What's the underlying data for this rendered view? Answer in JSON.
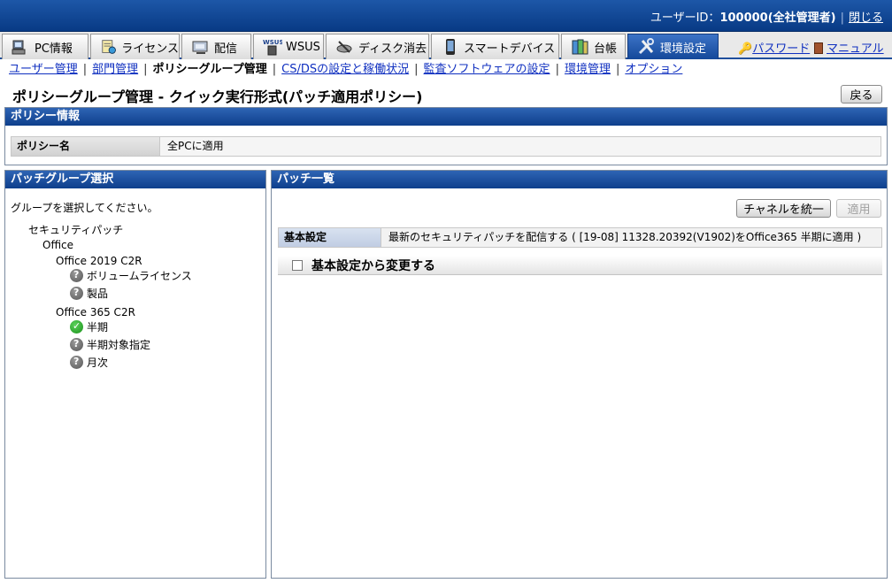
{
  "header": {
    "user_label": "ユーザーID：",
    "user_value": "100000(全社管理者)",
    "close_label": "閉じる"
  },
  "menu": {
    "tabs": [
      {
        "label": "PC情報",
        "icon": "pc-icon"
      },
      {
        "label": "ライセンス",
        "icon": "license-icon"
      },
      {
        "label": "配信",
        "icon": "distribution-icon"
      },
      {
        "label": "WSUS",
        "icon": "wsus-icon"
      },
      {
        "label": "ディスク消去",
        "icon": "disk-erase-icon"
      },
      {
        "label": "スマートデバイス",
        "icon": "smart-device-icon"
      },
      {
        "label": "台帳",
        "icon": "ledger-icon"
      },
      {
        "label": "環境設定",
        "icon": "settings-tools-icon"
      }
    ],
    "password_label": "パスワード",
    "manual_label": "マニュアル"
  },
  "subnav": {
    "items": [
      "ユーザー管理",
      "部門管理",
      "ポリシーグループ管理",
      "CS/DSの設定と稼働状況",
      "監査ソフトウェアの設定",
      "環境管理",
      "オプション"
    ]
  },
  "page": {
    "title": "ポリシーグループ管理 - クイック実行形式(パッチ適用ポリシー)",
    "back_label": "戻る"
  },
  "policy_info": {
    "heading": "ポリシー情報",
    "name_label": "ポリシー名",
    "name_value": "全PCに適用"
  },
  "patch_group": {
    "heading": "パッチグループ選択",
    "instruction": "グループを選択してください。",
    "tree": {
      "root": "セキュリティパッチ",
      "level1": "Office",
      "group_a": "Office 2019 C2R",
      "group_a_items": [
        {
          "label": "ボリュームライセンス",
          "status": "unknown"
        },
        {
          "label": "製品",
          "status": "unknown"
        }
      ],
      "group_b": "Office 365 C2R",
      "group_b_items": [
        {
          "label": "半期",
          "status": "applied"
        },
        {
          "label": "半期対象指定",
          "status": "unknown"
        },
        {
          "label": "月次",
          "status": "unknown"
        }
      ]
    }
  },
  "patch_list": {
    "heading": "パッチ一覧",
    "unify_label": "チャネルを統一",
    "apply_label": "適用",
    "basic_label": "基本設定",
    "basic_value": "最新のセキュリティパッチを配信する ( [19-08] 11328.20392(V1902)をOffice365 半期に適用 )",
    "change_label": "基本設定から変更する"
  }
}
